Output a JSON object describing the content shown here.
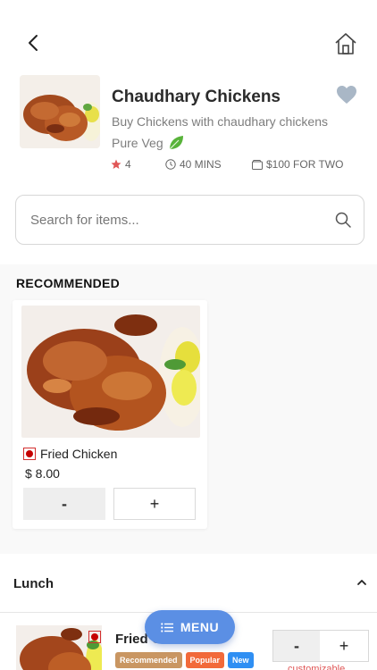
{
  "nav": {
    "back_icon": "chevron-left-icon",
    "home_icon": "home-icon"
  },
  "restaurant": {
    "name": "Chaudhary Chickens",
    "description": "Buy Chickens with chaudhary chickens",
    "diet": "Pure Veg",
    "diet_icon": "leaf-icon",
    "favorite_icon": "heart-icon",
    "rating": "4",
    "time": "40 MINS",
    "cost": "$100 FOR TWO"
  },
  "search": {
    "placeholder": "Search for items...",
    "value": ""
  },
  "recommended": {
    "title": "RECOMMENDED",
    "items": [
      {
        "name": "Fried Chicken",
        "price": "$ 8.00",
        "minus_label": "-",
        "plus_label": "+"
      }
    ]
  },
  "lunch": {
    "title": "Lunch",
    "items": [
      {
        "name": "Fried C",
        "badges": [
          "Recommended",
          "Popular",
          "New"
        ],
        "minus_label": "-",
        "plus_label": "+",
        "note": "customizable"
      }
    ]
  },
  "menu_button": {
    "label": "MENU"
  },
  "colors": {
    "accent": "#5b8fe4",
    "veg_mark": "#c50000",
    "badge_recommended": "#c99662",
    "badge_popular": "#f26a3a",
    "badge_new": "#2f8ff3",
    "rating_star": "#e05656",
    "leaf": "#58b33a",
    "heart": "#a9b7c6"
  }
}
